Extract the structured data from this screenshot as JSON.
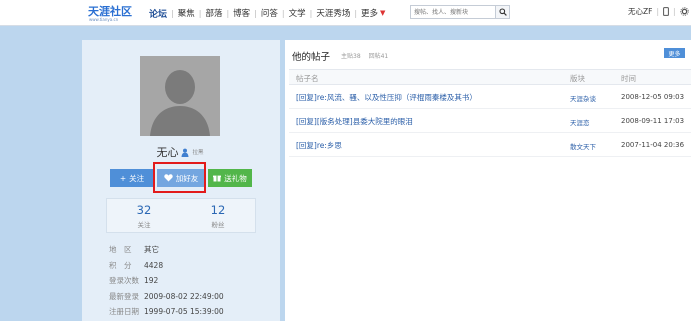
{
  "logo": {
    "main": "天涯社区",
    "sub": "www.tianya.cn"
  },
  "nav": {
    "items": [
      "论坛",
      "聚焦",
      "部落",
      "博客",
      "问答",
      "文学",
      "天涯秀场",
      "更多"
    ]
  },
  "search": {
    "placeholder": "搜帖、找人、搜新块"
  },
  "user_area": {
    "name": "无心ZF",
    "icon1": "mobile-icon",
    "icon2": "settings-icon"
  },
  "profile": {
    "name": "无心",
    "tag": "拉黑",
    "buttons": {
      "follow": "关注",
      "add_friend": "加好友",
      "gift": "送礼物"
    },
    "stats": [
      {
        "num": "32",
        "label": "关注"
      },
      {
        "num": "12",
        "label": "粉丝"
      }
    ],
    "info": [
      {
        "key": "地　区",
        "value": "其它"
      },
      {
        "key": "积　分",
        "value": "4428"
      },
      {
        "key": "登录次数",
        "value": "192"
      },
      {
        "key": "最新登录",
        "value": "2009-08-02 22:49:00"
      },
      {
        "key": "注册日期",
        "value": "1999-07-05 15:39:00"
      }
    ]
  },
  "posts": {
    "title": "他的帖子",
    "main_count": "主贴38",
    "reply_count": "回帖41",
    "more": "更多",
    "headers": {
      "title": "帖子名",
      "board": "版块",
      "time": "时间"
    },
    "rows": [
      {
        "title": "[回复]re:风流、骚、以及性压抑（评棍雨秦楼及其书）",
        "board": "天涯杂谈",
        "time": "2008-12-05 09:03"
      },
      {
        "title": "[回复][版务处理]县委大院里的眼泪",
        "board": "天涯恋",
        "time": "2008-09-11 17:03"
      },
      {
        "title": "[回复]re:乡思",
        "board": "散文天下",
        "time": "2007-11-04 20:36"
      }
    ]
  },
  "colors": {
    "accent": "#4f8fd8",
    "green": "#52b64a",
    "highlight": "#e21b1b",
    "page_bg": "#bcd6ee"
  }
}
